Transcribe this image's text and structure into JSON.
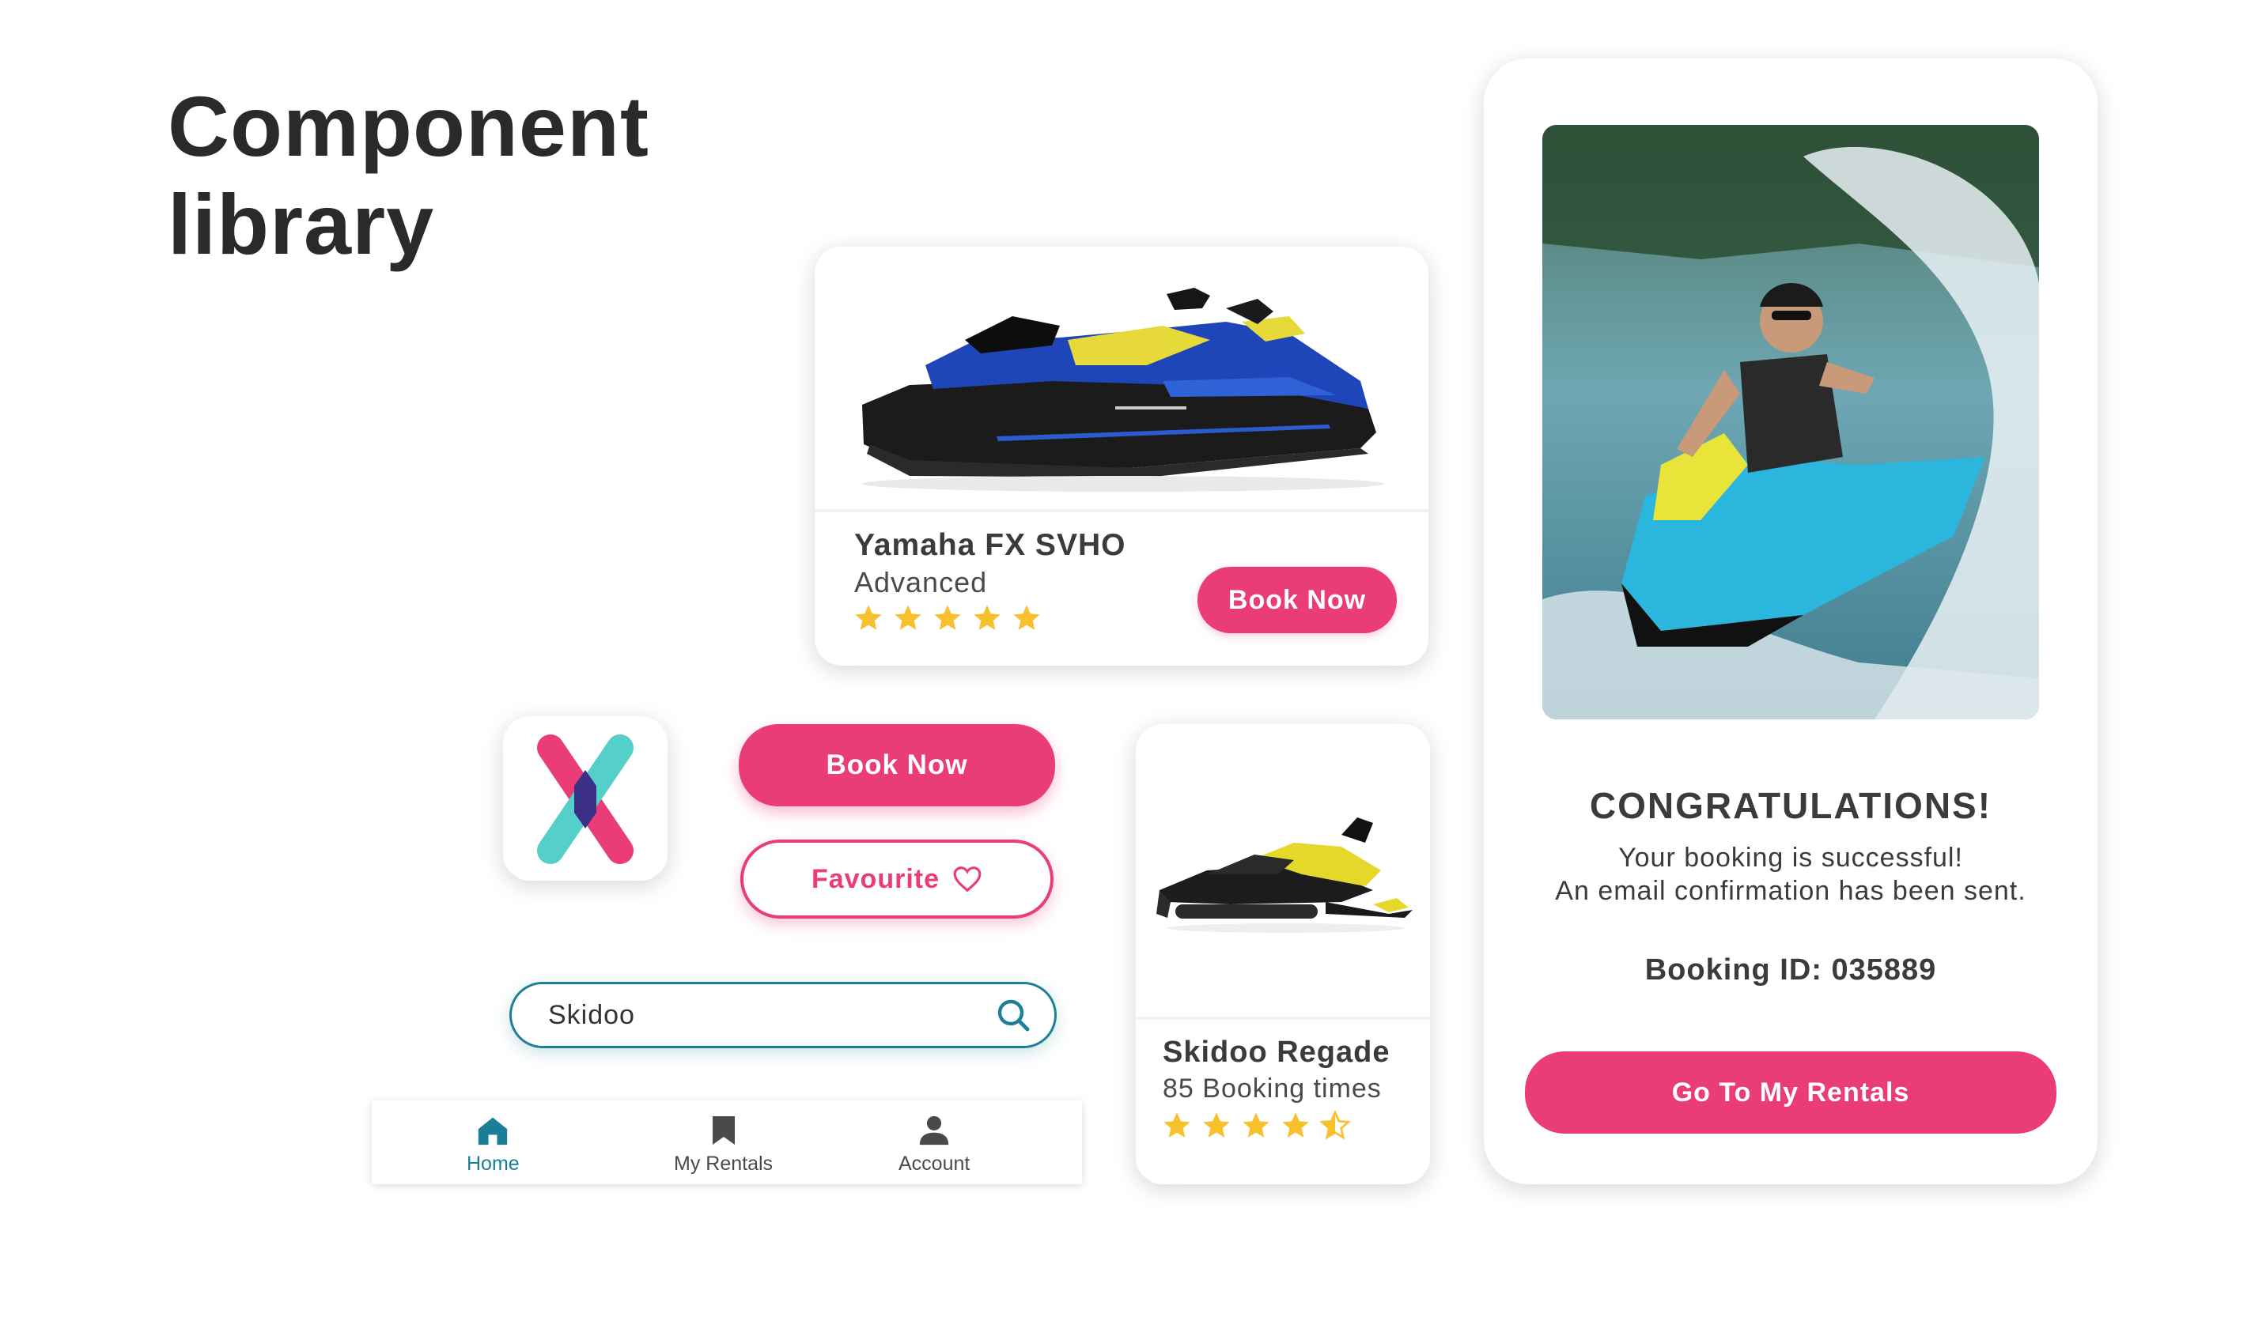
{
  "page": {
    "title_line1": "Component",
    "title_line2": "library"
  },
  "product_card": {
    "name": "Yamaha FX SVHO",
    "level": "Advanced",
    "rating": 5,
    "book_label": "Book Now"
  },
  "buttons": {
    "book_label": "Book Now",
    "favourite_label": "Favourite"
  },
  "search": {
    "value": "Skidoo"
  },
  "bottom_nav": {
    "items": [
      {
        "label": "Home",
        "icon": "home-icon",
        "active": true
      },
      {
        "label": "My Rentals",
        "icon": "bookmark-icon",
        "active": false
      },
      {
        "label": "Account",
        "icon": "person-icon",
        "active": false
      }
    ]
  },
  "skidoo_card": {
    "name": "Skidoo Regade",
    "bookings": "85 Booking times",
    "rating": 4.5
  },
  "confirmation": {
    "title": "CONGRATULATIONS!",
    "message_line1": "Your booking is successful!",
    "message_line2": "An email confirmation has been sent.",
    "booking_id": "Booking ID: 035889",
    "button_label": "Go To My Rentals"
  },
  "colors": {
    "primary_pink": "#ea3d78",
    "teal": "#1a7e98",
    "star_yellow": "#f8c02d",
    "text_dark": "#3b3b3b"
  }
}
